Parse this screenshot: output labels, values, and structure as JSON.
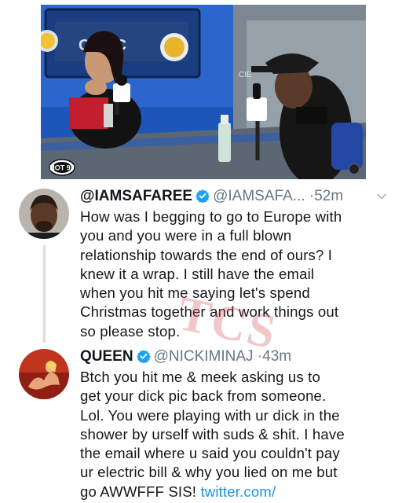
{
  "colors": {
    "verified_blue": "#1da1f2",
    "link_blue": "#1b95e0",
    "muted_gray": "#657786",
    "text_dark": "#14171a",
    "watermark_red": "#d6505a"
  },
  "video": {
    "logo_text": "HOT 97",
    "corner_icon": "settings-icon"
  },
  "watermark": {
    "text": "TCS"
  },
  "tweets": [
    {
      "avatar_icon": "profile-photo",
      "display_name": "@IAMSAFAREE",
      "handle": "@IAMSAFA...",
      "separator": "·",
      "timestamp": "52m",
      "caret_icon": "chevron-down-icon",
      "body_lines": [
        "How was I begging to go to Europe with",
        "you and you were in a full blown",
        "relationship towards the end of ours? I",
        "knew it a wrap. I still have the email",
        "when you hit me saying let's spend",
        "Christmas together and work things out",
        "so please stop."
      ]
    },
    {
      "avatar_icon": "profile-photo",
      "display_name": "QUEEN",
      "handle": "@NICKIMINAJ",
      "separator": "·",
      "timestamp": "43m",
      "body_lines": [
        "Btch you hit me & meek asking us to",
        "get your dick pic back from someone.",
        "Lol. You were playing with ur dick in the",
        "shower by urself with suds & shit. I have",
        "the email where u said you couldn't pay",
        "ur electric bill & why you lied on me but"
      ],
      "last_line_text": "go AWWFFF SIS!",
      "link_text": "twitter.com/"
    }
  ]
}
